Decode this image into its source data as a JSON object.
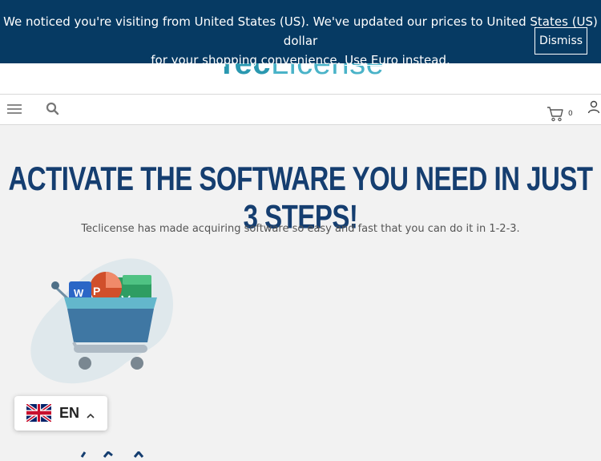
{
  "notice": {
    "text_line1": "We noticed you're visiting from United States (US). We've updated our prices to United States (US) dollar",
    "text_line2": "for your shopping convenience.",
    "link": "Use Euro instead.",
    "dismiss": "Dismiss"
  },
  "header": {
    "logo_part1": "Tec",
    "logo_part2": "License"
  },
  "navbar": {
    "menu_icon": "hamburger-icon",
    "search_icon": "search-icon",
    "cart_icon": "cart-icon",
    "cart_count": "0",
    "account_icon": "user-icon"
  },
  "hero": {
    "title": "Activate the software you need in just 3 steps!",
    "subtitle": "Teclicense has made acquiring software so easy and fast that you can do it in 1-2-3."
  },
  "language": {
    "code": "EN",
    "flag_icon": "uk-flag-icon",
    "chevron_icon": "chevron-up-icon"
  },
  "colors": {
    "notice_bg": "#063a63",
    "title": "#153e70",
    "logo": "#2a98b0"
  }
}
